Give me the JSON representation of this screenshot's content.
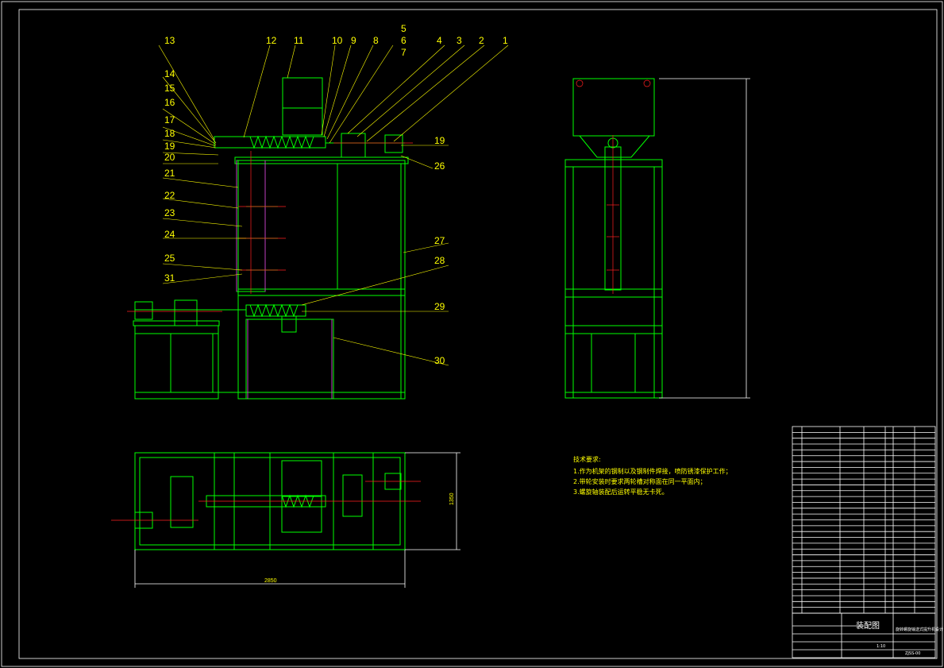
{
  "front_view_labels_top": [
    "13",
    "12",
    "11",
    "10",
    "9",
    "8",
    "5",
    "6",
    "7",
    "4",
    "3",
    "2",
    "1"
  ],
  "front_view_labels_left": [
    "14",
    "15",
    "16",
    "17",
    "18",
    "19",
    "20",
    "21",
    "22",
    "23",
    "24",
    "25",
    "31"
  ],
  "front_view_labels_right": [
    "19",
    "26",
    "27",
    "28",
    "29",
    "30"
  ],
  "plan_view_dims": {
    "width": "2850",
    "depth": "1350"
  },
  "tech_notes": {
    "heading": "技术要求:",
    "lines": [
      "1.作为机架的钢制以及钢制件焊接，喷防锈漆保护工作；",
      "2.带轮安装时要求两轮槽对称面在同一平面内；",
      "3.螺旋轴装配后运转平稳无卡死。"
    ]
  },
  "title_block": {
    "drawing_name": "装配图",
    "product_name": "旋转螺旋输送式提升机设计",
    "drawing_no": "ZJSS-00",
    "scale": "1:10"
  },
  "colors": {
    "background": "#000000",
    "outline": "#00ff00",
    "labels": "#ffff00",
    "centerline": "#ff2020",
    "hatch": "#c040c0",
    "frame": "#ffffff"
  }
}
